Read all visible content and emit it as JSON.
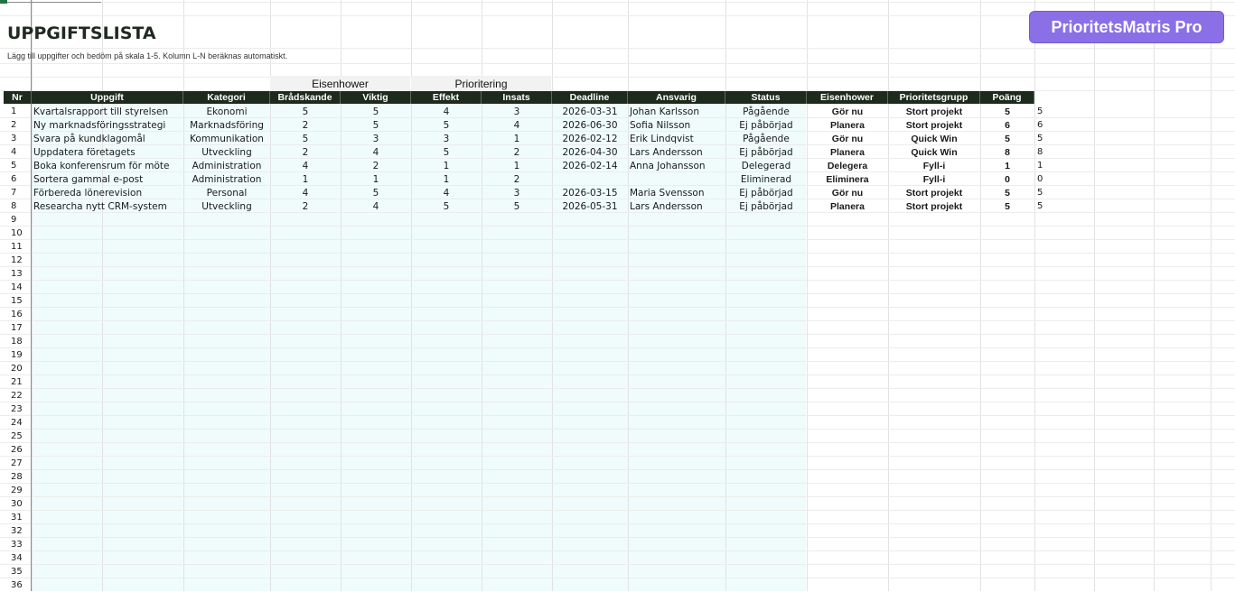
{
  "sheet": {
    "title": "UPPGIFTSLISTA",
    "subtitle": "Lägg till uppgifter och bedöm på skala 1-5. Kolumn L-N beräknas automatiskt.",
    "brand_button": "PrioritetsMatris Pro",
    "group_headers": {
      "eisenhower": "Eisenhower",
      "prioritering": "Prioritering"
    },
    "columns": [
      "Nr",
      "Uppgift",
      "Kategori",
      "Brådskande",
      "Viktig",
      "Effekt",
      "Insats",
      "Deadline",
      "Ansvarig",
      "Status",
      "Eisenhower",
      "Prioritetsgrupp",
      "Poäng"
    ]
  },
  "rows": [
    {
      "nr": "1",
      "uppgift": "Kvartalsrapport till styrelsen",
      "kategori": "Ekonomi",
      "bradskande": "5",
      "viktig": "5",
      "effekt": "4",
      "insats": "3",
      "deadline": "2026-03-31",
      "ansvarig": "Johan Karlsson",
      "status": "Pågående",
      "eisenhower": "Gör nu",
      "prioritetsgrupp": "Stort projekt",
      "poang": "5",
      "extra": "5"
    },
    {
      "nr": "2",
      "uppgift": "Ny marknadsföringsstrategi",
      "kategori": "Marknadsföring",
      "bradskande": "2",
      "viktig": "5",
      "effekt": "5",
      "insats": "4",
      "deadline": "2026-06-30",
      "ansvarig": "Sofia Nilsson",
      "status": "Ej påbörjad",
      "eisenhower": "Planera",
      "prioritetsgrupp": "Stort projekt",
      "poang": "6",
      "extra": "6"
    },
    {
      "nr": "3",
      "uppgift": "Svara på kundklagomål",
      "kategori": "Kommunikation",
      "bradskande": "5",
      "viktig": "3",
      "effekt": "3",
      "insats": "1",
      "deadline": "2026-02-12",
      "ansvarig": "Erik Lindqvist",
      "status": "Pågående",
      "eisenhower": "Gör nu",
      "prioritetsgrupp": "Quick Win",
      "poang": "5",
      "extra": "5"
    },
    {
      "nr": "4",
      "uppgift": "Uppdatera företagets",
      "kategori": "Utveckling",
      "bradskande": "2",
      "viktig": "4",
      "effekt": "5",
      "insats": "2",
      "deadline": "2026-04-30",
      "ansvarig": "Lars Andersson",
      "status": "Ej påbörjad",
      "eisenhower": "Planera",
      "prioritetsgrupp": "Quick Win",
      "poang": "8",
      "extra": "8"
    },
    {
      "nr": "5",
      "uppgift": "Boka konferensrum för möte",
      "kategori": "Administration",
      "bradskande": "4",
      "viktig": "2",
      "effekt": "1",
      "insats": "1",
      "deadline": "2026-02-14",
      "ansvarig": "Anna Johansson",
      "status": "Delegerad",
      "eisenhower": "Delegera",
      "prioritetsgrupp": "Fyll-i",
      "poang": "1",
      "extra": "1"
    },
    {
      "nr": "6",
      "uppgift": "Sortera gammal e-post",
      "kategori": "Administration",
      "bradskande": "1",
      "viktig": "1",
      "effekt": "1",
      "insats": "2",
      "deadline": "",
      "ansvarig": "",
      "status": "Eliminerad",
      "eisenhower": "Eliminera",
      "prioritetsgrupp": "Fyll-i",
      "poang": "0",
      "extra": "0"
    },
    {
      "nr": "7",
      "uppgift": "Förbereda lönerevision",
      "kategori": "Personal",
      "bradskande": "4",
      "viktig": "5",
      "effekt": "4",
      "insats": "3",
      "deadline": "2026-03-15",
      "ansvarig": "Maria Svensson",
      "status": "Ej påbörjad",
      "eisenhower": "Gör nu",
      "prioritetsgrupp": "Stort projekt",
      "poang": "5",
      "extra": "5"
    },
    {
      "nr": "8",
      "uppgift": "Researcha nytt CRM-system",
      "kategori": "Utveckling",
      "bradskande": "2",
      "viktig": "4",
      "effekt": "5",
      "insats": "5",
      "deadline": "2026-05-31",
      "ansvarig": "Lars Andersson",
      "status": "Ej påbörjad",
      "eisenhower": "Planera",
      "prioritetsgrupp": "Stort projekt",
      "poang": "5",
      "extra": "5"
    }
  ],
  "empty_row_numbers": [
    "9",
    "10",
    "11",
    "12",
    "13",
    "14",
    "15",
    "16",
    "17",
    "18",
    "19",
    "20",
    "21",
    "22",
    "23",
    "24",
    "25",
    "26",
    "27",
    "28",
    "29",
    "30",
    "31",
    "32",
    "33",
    "34",
    "35",
    "36"
  ],
  "colors": {
    "header_bg": "#1d2b1d",
    "input_tint": "#effcfb",
    "brand": "#8b6fe6"
  }
}
